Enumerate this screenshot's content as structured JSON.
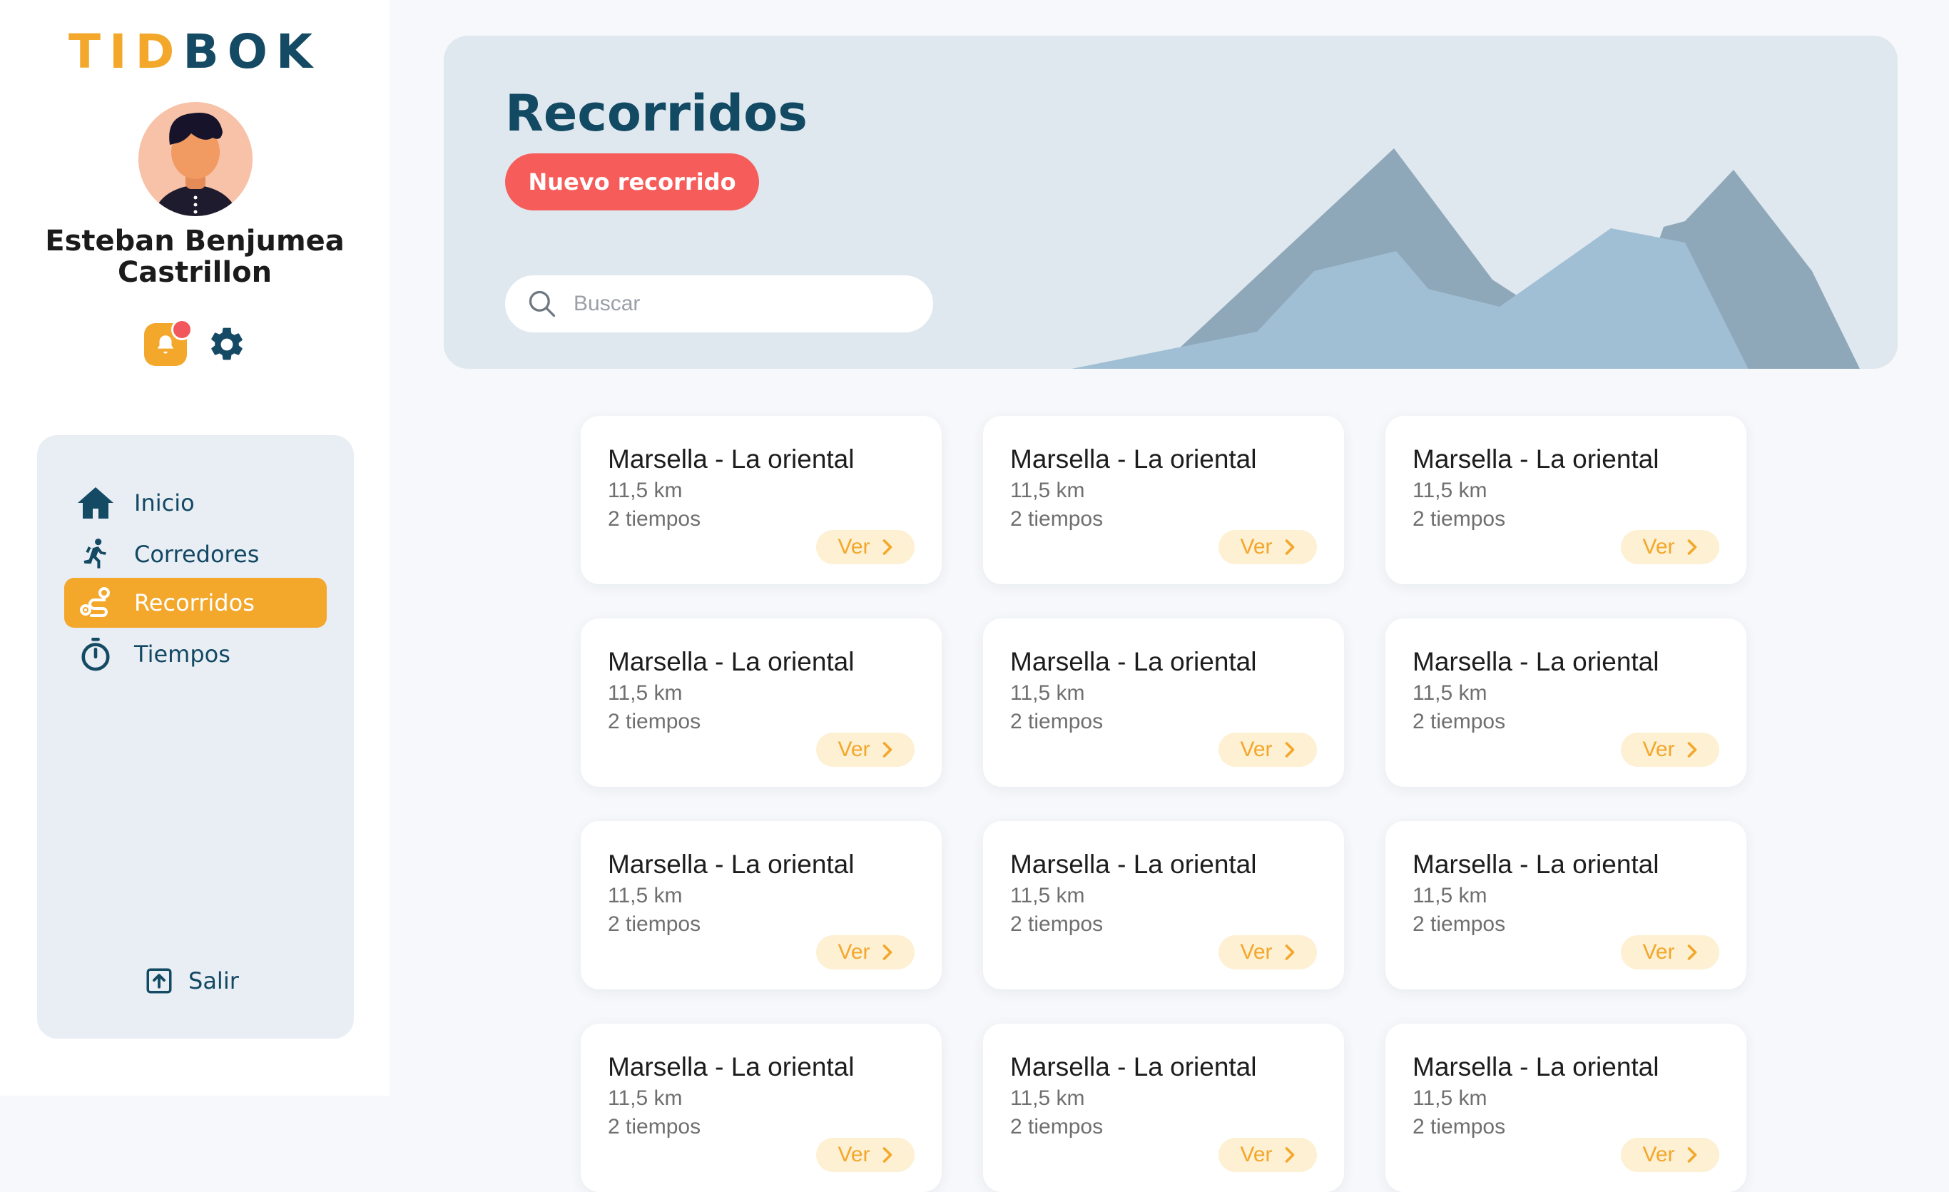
{
  "app": {
    "logo_part1": "TID",
    "logo_part2": "BOK"
  },
  "user": {
    "name_line1": "Esteban Benjumea",
    "name_line2": "Castrillon"
  },
  "icons": {
    "notification": "bell-icon",
    "settings": "gear-icon",
    "search": "search-icon",
    "logout": "logout-icon"
  },
  "nav": {
    "items": [
      {
        "label": "Inicio",
        "icon": "home-icon"
      },
      {
        "label": "Corredores",
        "icon": "runner-icon"
      },
      {
        "label": "Recorridos",
        "icon": "route-icon",
        "active": true
      },
      {
        "label": "Tiempos",
        "icon": "stopwatch-icon"
      }
    ],
    "logout_label": "Salir"
  },
  "header": {
    "title": "Recorridos",
    "new_button": "Nuevo recorrido",
    "search_placeholder": "Buscar",
    "search_value": ""
  },
  "cards": [
    {
      "title": "Marsella - La oriental",
      "distance": "11,5 km",
      "times": "2 tiempos",
      "action": "Ver"
    },
    {
      "title": "Marsella - La oriental",
      "distance": "11,5 km",
      "times": "2 tiempos",
      "action": "Ver"
    },
    {
      "title": "Marsella - La oriental",
      "distance": "11,5 km",
      "times": "2 tiempos",
      "action": "Ver"
    },
    {
      "title": "Marsella - La oriental",
      "distance": "11,5 km",
      "times": "2 tiempos",
      "action": "Ver"
    },
    {
      "title": "Marsella - La oriental",
      "distance": "11,5 km",
      "times": "2 tiempos",
      "action": "Ver"
    },
    {
      "title": "Marsella - La oriental",
      "distance": "11,5 km",
      "times": "2 tiempos",
      "action": "Ver"
    },
    {
      "title": "Marsella - La oriental",
      "distance": "11,5 km",
      "times": "2 tiempos",
      "action": "Ver"
    },
    {
      "title": "Marsella - La oriental",
      "distance": "11,5 km",
      "times": "2 tiempos",
      "action": "Ver"
    },
    {
      "title": "Marsella - La oriental",
      "distance": "11,5 km",
      "times": "2 tiempos",
      "action": "Ver"
    },
    {
      "title": "Marsella - La oriental",
      "distance": "11,5 km",
      "times": "2 tiempos",
      "action": "Ver"
    },
    {
      "title": "Marsella - La oriental",
      "distance": "11,5 km",
      "times": "2 tiempos",
      "action": "Ver"
    },
    {
      "title": "Marsella - La oriental",
      "distance": "11,5 km",
      "times": "2 tiempos",
      "action": "Ver"
    }
  ],
  "colors": {
    "brand_orange": "#f3a72b",
    "brand_navy": "#134a63",
    "accent_red": "#f65c5a",
    "panel_bg": "#e8eef4"
  }
}
